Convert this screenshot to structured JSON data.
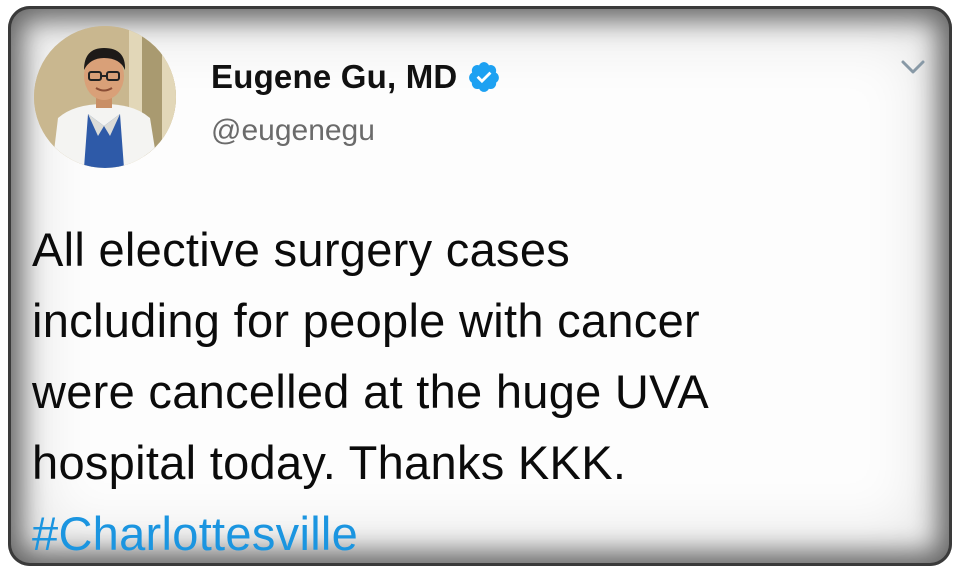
{
  "author": {
    "name": "Eugene Gu, MD",
    "handle": "@eugenegu",
    "verified": true,
    "avatar_icon": "profile-photo"
  },
  "tweet": {
    "lines": [
      "All elective surgery cases",
      "including for people with cancer",
      "were cancelled at the huge UVA",
      "hospital today. Thanks KKK."
    ],
    "hashtag": "#Charlottesville"
  },
  "menu": {
    "icon": "chevron-down-icon"
  },
  "colors": {
    "hashtag": "#1b95e0",
    "verified_badge": "#1da1f2",
    "text": "#0b0b0b",
    "handle": "#6b6b6b"
  }
}
